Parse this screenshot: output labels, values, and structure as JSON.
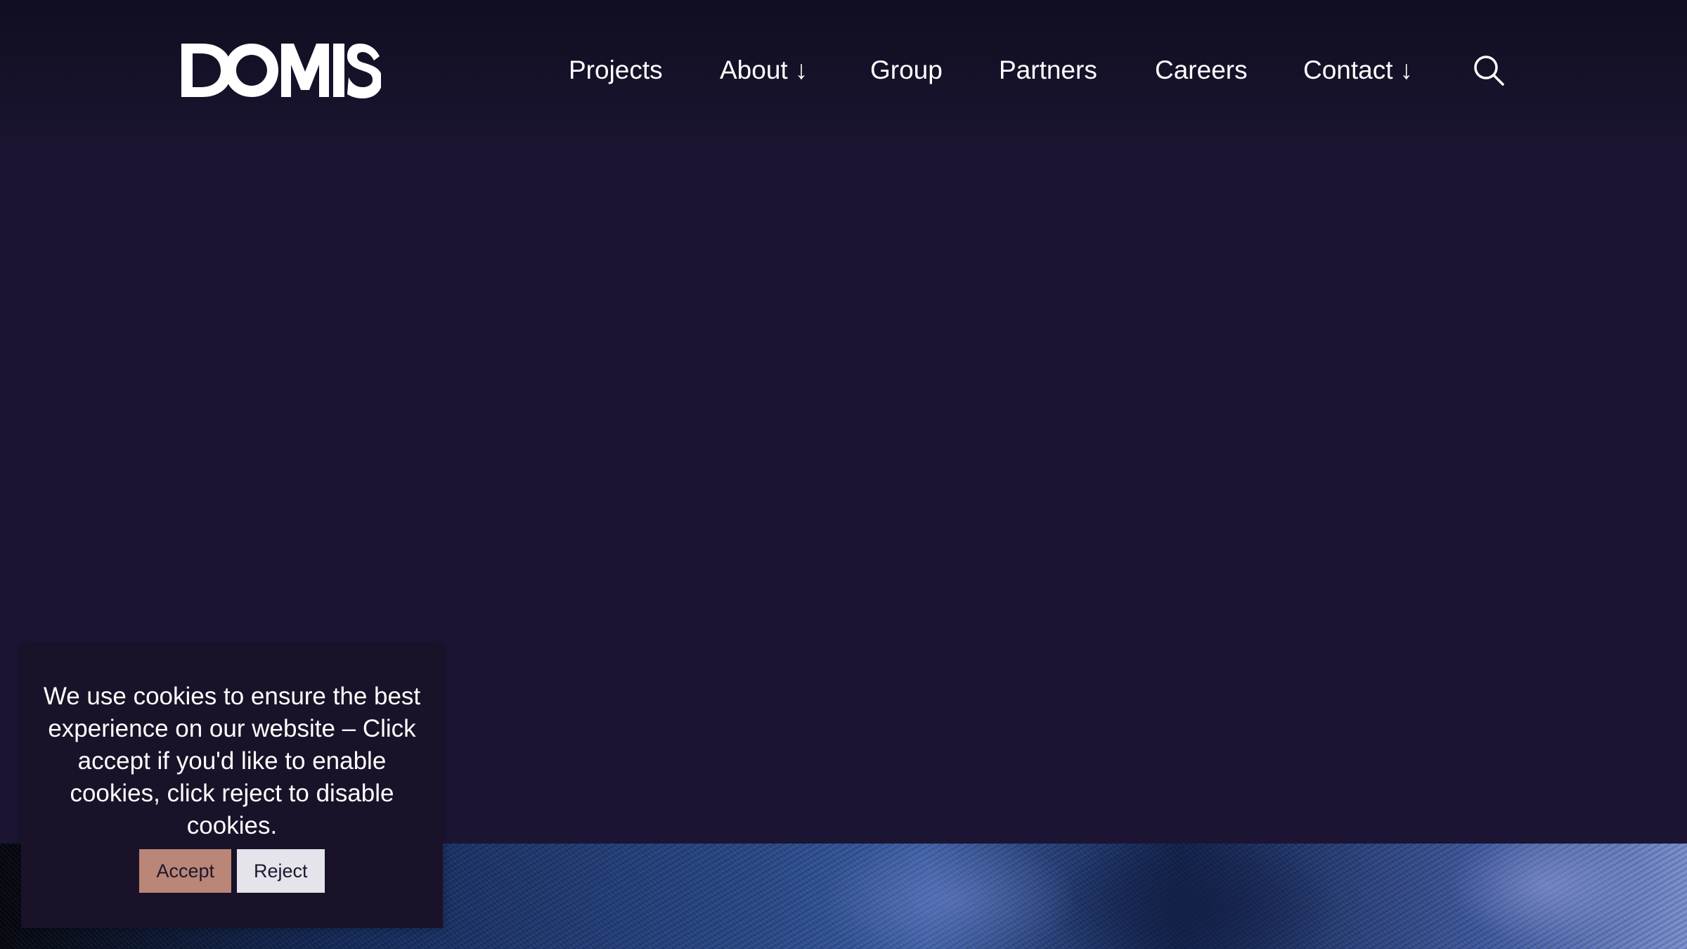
{
  "brand": {
    "logo_text": "DOMIS",
    "logo_icon": "domis-logo"
  },
  "nav": {
    "items": [
      {
        "label": "Projects",
        "has_dropdown": false
      },
      {
        "label": "About",
        "has_dropdown": true,
        "arrow": "↓"
      },
      {
        "label": "Group",
        "has_dropdown": false
      },
      {
        "label": "Partners",
        "has_dropdown": false
      },
      {
        "label": "Careers",
        "has_dropdown": false
      },
      {
        "label": "Contact",
        "has_dropdown": true,
        "arrow": "↓"
      }
    ],
    "search_icon": "search-icon"
  },
  "cookie": {
    "message": "We use cookies to ensure the best experience on our website – Click accept if you'd like to enable cookies, click reject to disable cookies.",
    "accept_label": "Accept",
    "reject_label": "Reject"
  },
  "colors": {
    "background": "#1b1533",
    "accent": "#b98677",
    "text": "#ffffff"
  }
}
